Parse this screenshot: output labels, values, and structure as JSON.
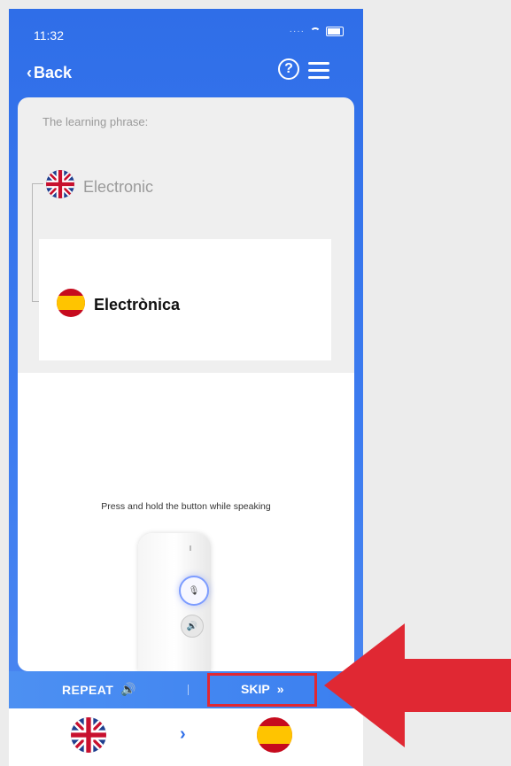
{
  "status_bar": {
    "time": "11:32"
  },
  "header": {
    "back_label": "Back",
    "help_icon": "question-circle-icon",
    "menu_icon": "hamburger-menu-icon"
  },
  "lesson": {
    "phrase_label": "The learning phrase:",
    "source_phrase": "Electronic",
    "target_phrase": "Electrònica",
    "source_flag": "uk-flag-icon",
    "target_flag": "spain-flag-icon",
    "instruction": "Press and hold the button while speaking"
  },
  "actions": {
    "repeat_label": "REPEAT",
    "skip_label": "SKIP"
  },
  "language_switcher": {
    "from_flag": "uk-flag-icon",
    "to_flag": "spain-flag-icon"
  },
  "colors": {
    "primary_blue": "#2f6ee8",
    "highlight_red": "#e02833"
  }
}
